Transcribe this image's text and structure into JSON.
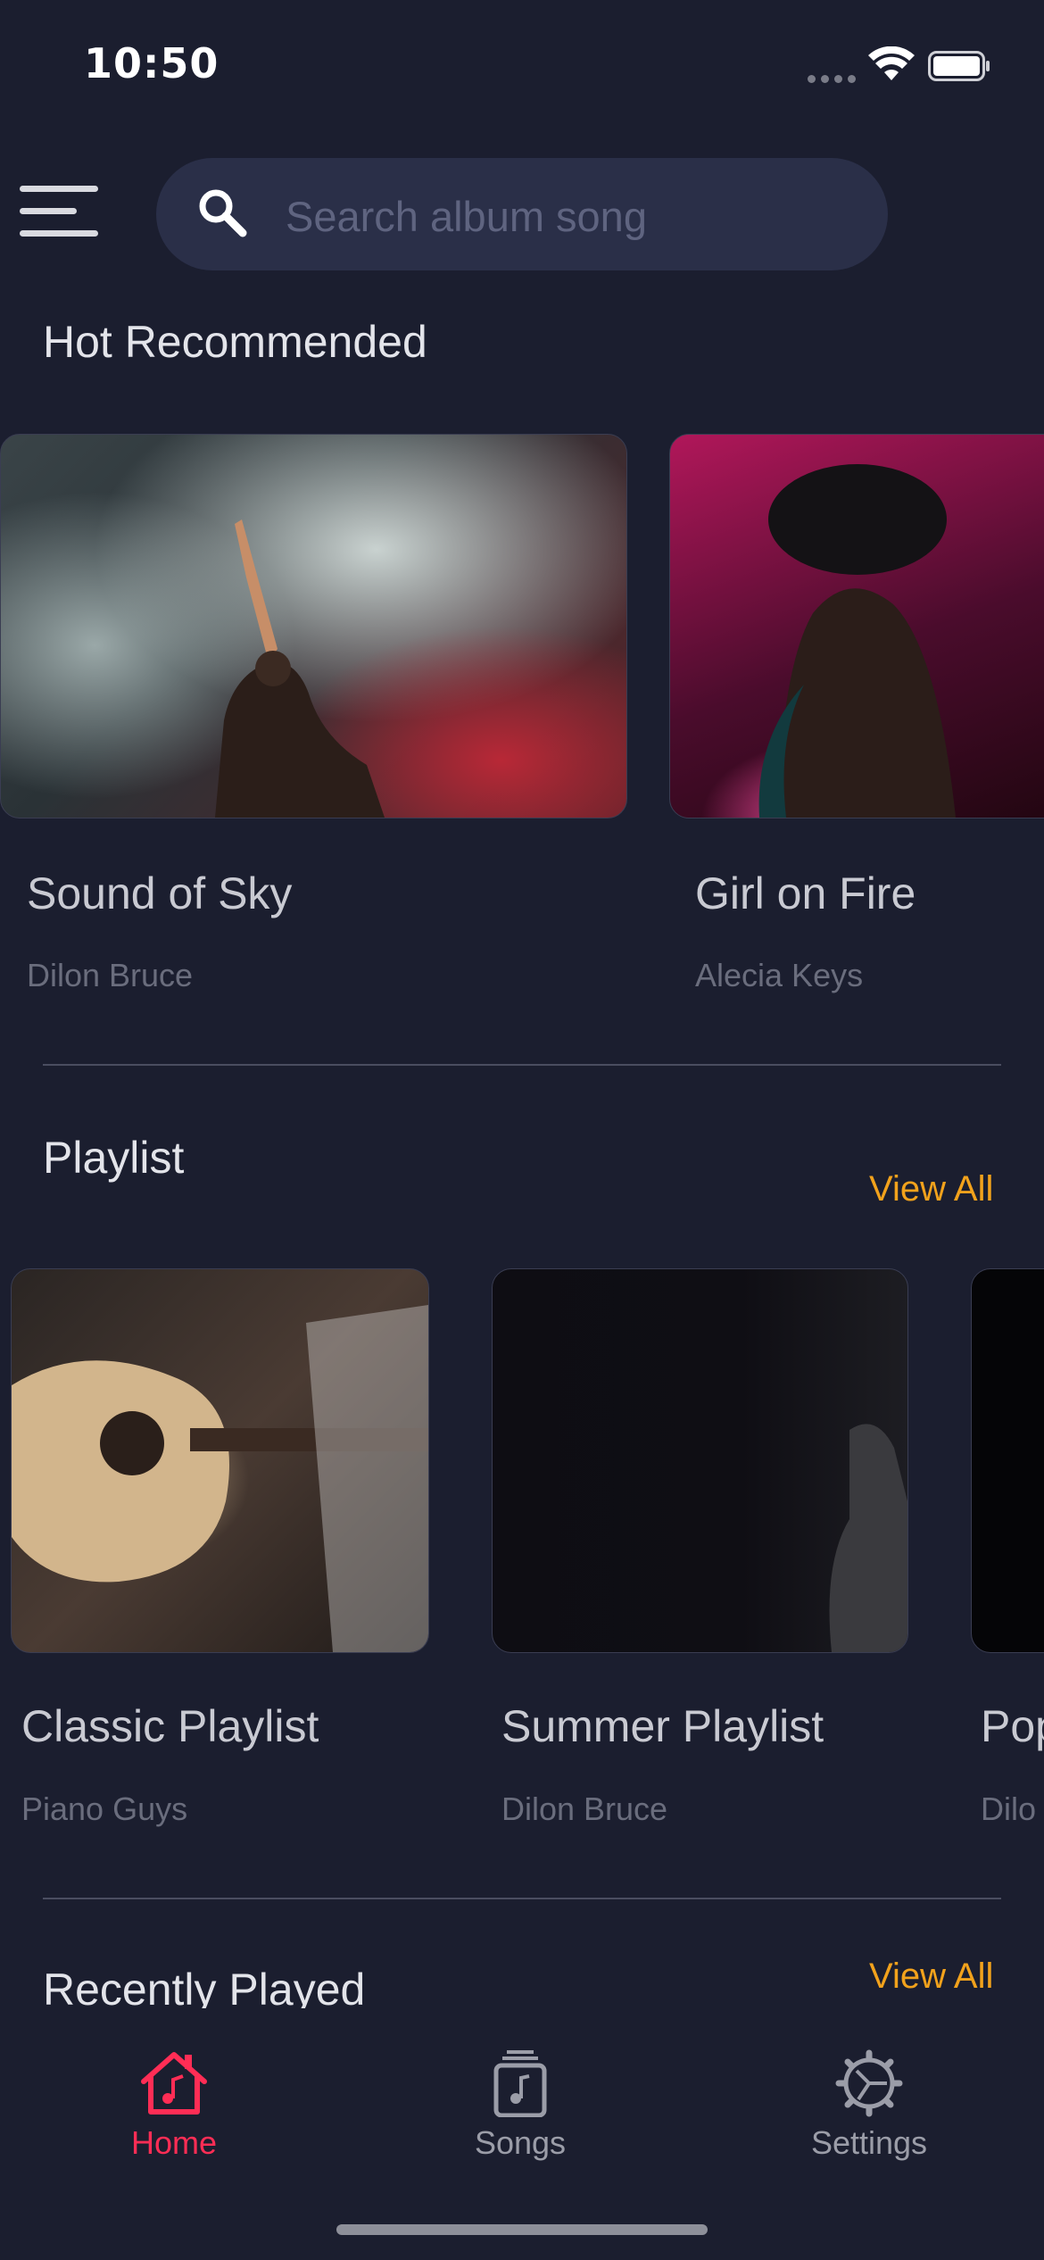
{
  "status_bar": {
    "time": "10:50"
  },
  "search": {
    "placeholder": "Search album song"
  },
  "hot_recommended": {
    "title": "Hot Recommended",
    "items": [
      {
        "title": "Sound of Sky",
        "artist": "Dilon Bruce"
      },
      {
        "title": "Girl on Fire",
        "artist": "Alecia Keys"
      }
    ]
  },
  "playlist": {
    "title": "Playlist",
    "view_all": "View All",
    "items": [
      {
        "title": "Classic Playlist",
        "artist": "Piano Guys"
      },
      {
        "title": "Summer Playlist",
        "artist": "Dilon Bruce"
      },
      {
        "title": "Pop",
        "artist": "Dilo"
      }
    ]
  },
  "recently_played": {
    "title": "Recently Played",
    "view_all": "View All"
  },
  "bottom_nav": {
    "items": [
      {
        "label": "Home",
        "active": true
      },
      {
        "label": "Songs",
        "active": false
      },
      {
        "label": "Settings",
        "active": false
      }
    ]
  },
  "colors": {
    "background": "#1b1e2f",
    "accent": "#ff2d55",
    "link": "#f2a21c",
    "search_bg": "#2a2f48"
  },
  "icons": [
    "signal-icon",
    "wifi-icon",
    "battery-icon",
    "menu-icon",
    "search-icon",
    "home-icon",
    "songs-icon",
    "settings-icon"
  ]
}
